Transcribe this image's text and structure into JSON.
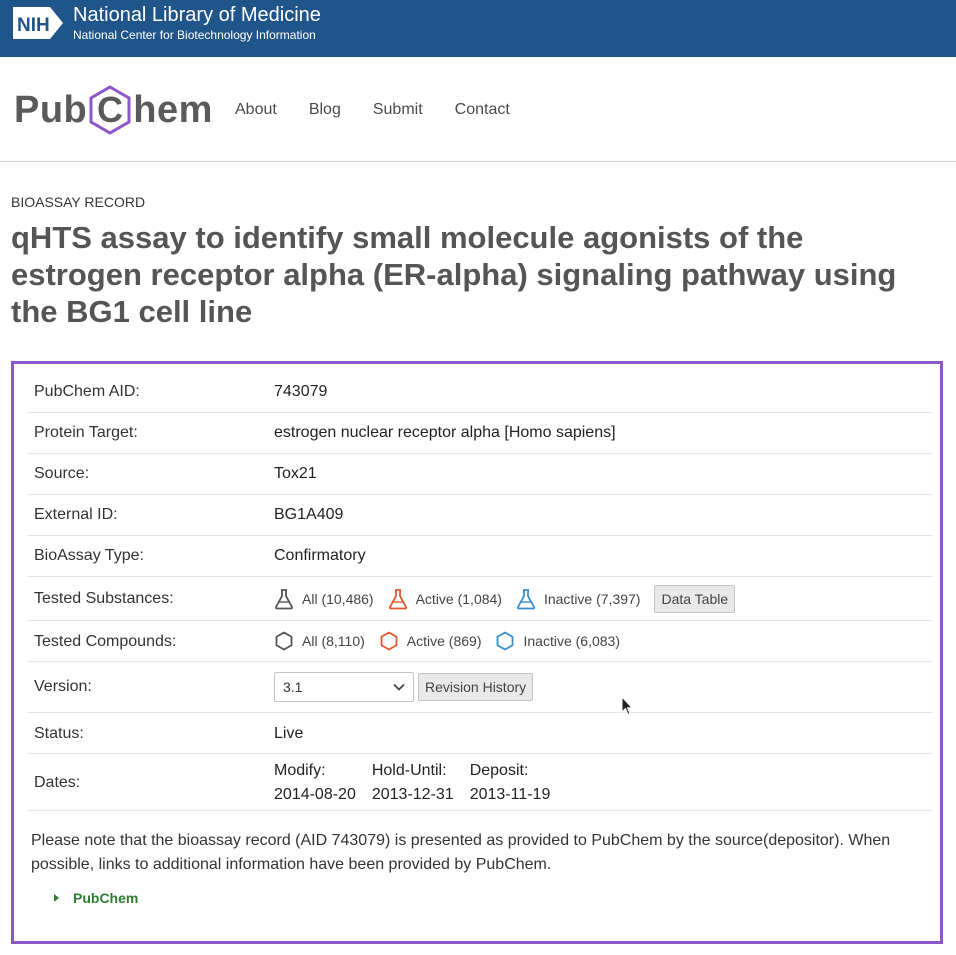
{
  "nih": {
    "logo_text": "NIH",
    "title": "National Library of Medicine",
    "subtitle": "National Center for Biotechnology Information"
  },
  "pubchem": {
    "logo_left": "Pub",
    "logo_mid": "C",
    "logo_right": "hem",
    "nav": [
      "About",
      "Blog",
      "Submit",
      "Contact"
    ]
  },
  "record": {
    "kind": "BIOASSAY RECORD",
    "title": "qHTS assay to identify small molecule agonists of the estrogen receptor alpha (ER-alpha) signaling pathway using the BG1 cell line"
  },
  "summary": {
    "aid_label": "PubChem AID:",
    "aid_value": "743079",
    "target_label": "Protein Target:",
    "target_value": "estrogen nuclear receptor alpha [Homo sapiens]",
    "source_label": "Source:",
    "source_value": "Tox21",
    "external_label": "External ID:",
    "external_value": "BG1A409",
    "type_label": "BioAssay Type:",
    "type_value": "Confirmatory",
    "substances_label": "Tested Substances:",
    "substances": {
      "all": "All (10,486)",
      "active": "Active (1,084)",
      "inactive": "Inactive (7,397)",
      "data_table_button": "Data Table"
    },
    "compounds_label": "Tested Compounds:",
    "compounds": {
      "all": "All (8,110)",
      "active": "Active (869)",
      "inactive": "Inactive (6,083)"
    },
    "version_label": "Version:",
    "version_selected": "3.1",
    "revision_button": "Revision History",
    "status_label": "Status:",
    "status_value": "Live",
    "dates_label": "Dates:",
    "dates": {
      "modify_label": "Modify:",
      "modify_value": "2014-08-20",
      "hold_label": "Hold-Until:",
      "hold_value": "2013-12-31",
      "deposit_label": "Deposit:",
      "deposit_value": "2013-11-19"
    },
    "note": "Please note that the bioassay record (AID 743079) is presented as provided to PubChem by the source(depositor). When possible, links to additional information have been provided by PubChem.",
    "disclosure_label": "PubChem"
  },
  "colors": {
    "nih_blue": "#20558a",
    "accent_purple": "#8d57cc",
    "link_blue": "#1565a8",
    "active_orange": "#e4572e",
    "inactive_blue": "#3a8fd0",
    "disclosure_green": "#2e7d32"
  }
}
